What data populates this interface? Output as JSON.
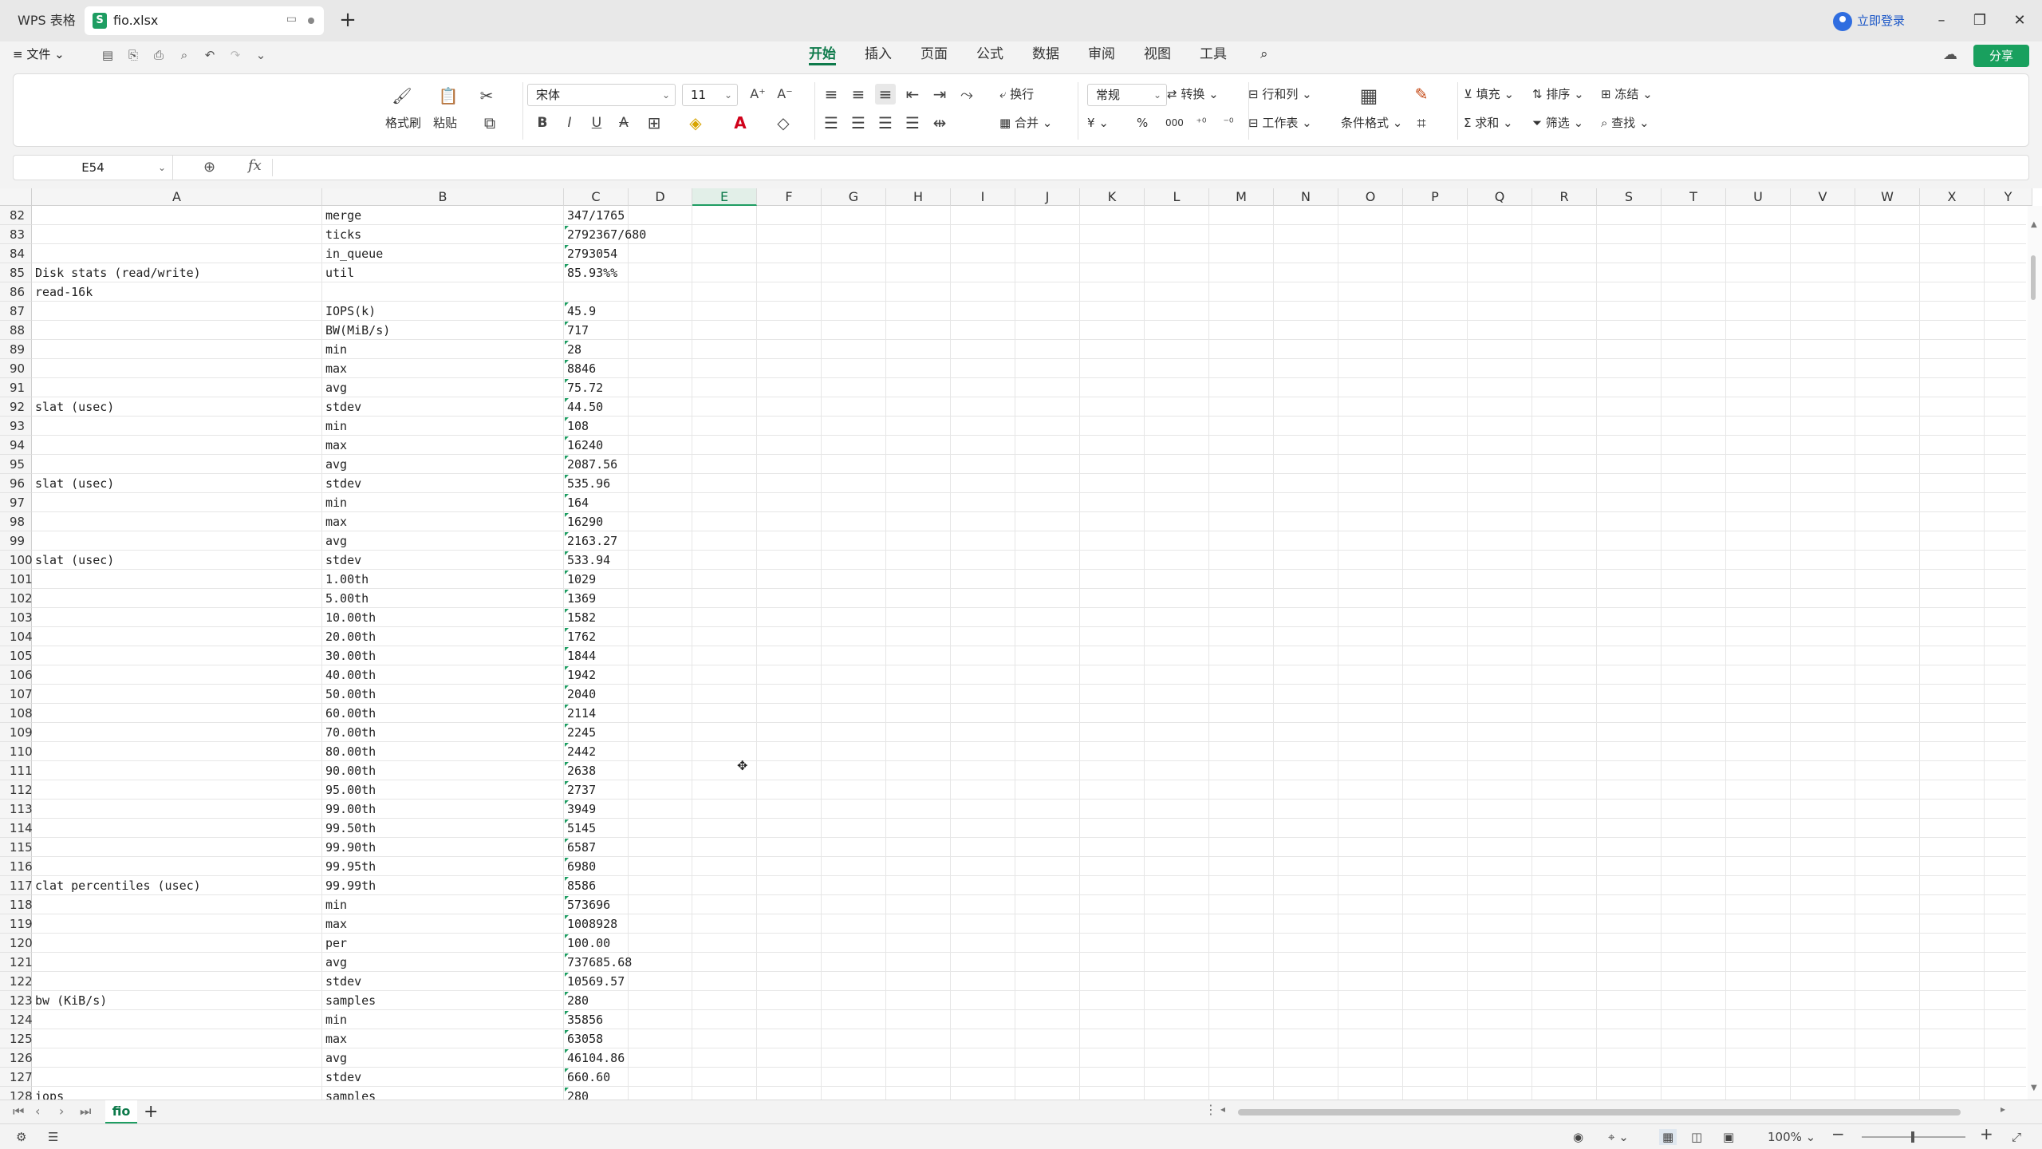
{
  "titlebar": {
    "app_tab": "WPS 表格",
    "file_tab": "fio.xlsx",
    "file_logo": "S",
    "login": "立即登录",
    "new_tab": "+"
  },
  "menubar": {
    "file": "≡ 文件 ⌄",
    "tabs": [
      "开始",
      "插入",
      "页面",
      "公式",
      "数据",
      "审阅",
      "视图",
      "工具"
    ],
    "active_tab": "开始",
    "share": "分享"
  },
  "ribbon": {
    "format_painter": "格式刷",
    "paste": "粘贴",
    "font_name": "宋体",
    "font_size": "11",
    "wrap": "换行",
    "merge": "合并",
    "number_format": "常规",
    "convert": "转换",
    "rows_cols": "行和列",
    "worksheet": "工作表",
    "cond_format": "条件格式",
    "fill": "填充",
    "sort": "排序",
    "freeze": "冻结",
    "sum": "求和",
    "filter": "筛选",
    "find": "查找",
    "currency": "¥",
    "percent": "%",
    "thousands": "000"
  },
  "formula_bar": {
    "cell_ref": "E54",
    "fx": "fx",
    "value": ""
  },
  "grid": {
    "columns": [
      {
        "name": "A"
      },
      {
        "name": "B"
      },
      {
        "name": "C"
      },
      {
        "name": "D"
      },
      {
        "name": "E"
      },
      {
        "name": "F"
      },
      {
        "name": "G"
      },
      {
        "name": "H"
      },
      {
        "name": "I"
      },
      {
        "name": "J"
      },
      {
        "name": "K"
      },
      {
        "name": "L"
      },
      {
        "name": "M"
      },
      {
        "name": "N"
      },
      {
        "name": "O"
      },
      {
        "name": "P"
      },
      {
        "name": "Q"
      },
      {
        "name": "R"
      },
      {
        "name": "S"
      },
      {
        "name": "T"
      },
      {
        "name": "U"
      },
      {
        "name": "V"
      },
      {
        "name": "W"
      },
      {
        "name": "X"
      },
      {
        "name": "Y"
      }
    ],
    "selected_column": "E",
    "rows": [
      {
        "n": "82",
        "a": "",
        "b": "merge",
        "c": "347/1765",
        "tri": false
      },
      {
        "n": "83",
        "a": "",
        "b": "ticks",
        "c": "2792367/680",
        "tri": true
      },
      {
        "n": "84",
        "a": "",
        "b": "in_queue",
        "c": "2793054",
        "tri": true
      },
      {
        "n": "85",
        "a": "Disk stats (read/write)",
        "b": "util",
        "c": "85.93%%",
        "tri": true
      },
      {
        "n": "86",
        "a": "read-16k",
        "b": "",
        "c": "",
        "tri": false
      },
      {
        "n": "87",
        "a": "",
        "b": "IOPS(k)",
        "c": "45.9",
        "tri": true
      },
      {
        "n": "88",
        "a": "",
        "b": "BW(MiB/s)",
        "c": "717",
        "tri": true
      },
      {
        "n": "89",
        "a": "",
        "b": "min",
        "c": "28",
        "tri": true
      },
      {
        "n": "90",
        "a": "",
        "b": "max",
        "c": "8846",
        "tri": true
      },
      {
        "n": "91",
        "a": "",
        "b": "avg",
        "c": "75.72",
        "tri": true
      },
      {
        "n": "92",
        "a": "slat (usec)",
        "b": "stdev",
        "c": "44.50",
        "tri": true
      },
      {
        "n": "93",
        "a": "",
        "b": "min",
        "c": "108",
        "tri": true
      },
      {
        "n": "94",
        "a": "",
        "b": "max",
        "c": "16240",
        "tri": true
      },
      {
        "n": "95",
        "a": "",
        "b": "avg",
        "c": "2087.56",
        "tri": true
      },
      {
        "n": "96",
        "a": "slat (usec)",
        "b": "stdev",
        "c": "535.96",
        "tri": true
      },
      {
        "n": "97",
        "a": "",
        "b": "min",
        "c": "164",
        "tri": true
      },
      {
        "n": "98",
        "a": "",
        "b": "max",
        "c": "16290",
        "tri": true
      },
      {
        "n": "99",
        "a": "",
        "b": "avg",
        "c": "2163.27",
        "tri": true
      },
      {
        "n": "100",
        "a": "slat (usec)",
        "b": "stdev",
        "c": "533.94",
        "tri": true
      },
      {
        "n": "101",
        "a": "",
        "b": "1.00th",
        "c": "1029",
        "tri": true
      },
      {
        "n": "102",
        "a": "",
        "b": "5.00th",
        "c": "1369",
        "tri": true
      },
      {
        "n": "103",
        "a": "",
        "b": "10.00th",
        "c": "1582",
        "tri": true
      },
      {
        "n": "104",
        "a": "",
        "b": "20.00th",
        "c": "1762",
        "tri": true
      },
      {
        "n": "105",
        "a": "",
        "b": "30.00th",
        "c": "1844",
        "tri": true
      },
      {
        "n": "106",
        "a": "",
        "b": "40.00th",
        "c": "1942",
        "tri": true
      },
      {
        "n": "107",
        "a": "",
        "b": "50.00th",
        "c": "2040",
        "tri": true
      },
      {
        "n": "108",
        "a": "",
        "b": "60.00th",
        "c": "2114",
        "tri": true
      },
      {
        "n": "109",
        "a": "",
        "b": "70.00th",
        "c": "2245",
        "tri": true
      },
      {
        "n": "110",
        "a": "",
        "b": "80.00th",
        "c": "2442",
        "tri": true
      },
      {
        "n": "111",
        "a": "",
        "b": "90.00th",
        "c": "2638",
        "tri": true
      },
      {
        "n": "112",
        "a": "",
        "b": "95.00th",
        "c": "2737",
        "tri": true
      },
      {
        "n": "113",
        "a": "",
        "b": "99.00th",
        "c": "3949",
        "tri": true
      },
      {
        "n": "114",
        "a": "",
        "b": "99.50th",
        "c": "5145",
        "tri": true
      },
      {
        "n": "115",
        "a": "",
        "b": "99.90th",
        "c": "6587",
        "tri": true
      },
      {
        "n": "116",
        "a": "",
        "b": "99.95th",
        "c": "6980",
        "tri": true
      },
      {
        "n": "117",
        "a": "clat percentiles (usec)",
        "b": "99.99th",
        "c": "8586",
        "tri": true
      },
      {
        "n": "118",
        "a": "",
        "b": "min",
        "c": "573696",
        "tri": true
      },
      {
        "n": "119",
        "a": "",
        "b": "max",
        "c": "1008928",
        "tri": true
      },
      {
        "n": "120",
        "a": "",
        "b": "per",
        "c": "100.00",
        "tri": true
      },
      {
        "n": "121",
        "a": "",
        "b": "avg",
        "c": "737685.68",
        "tri": true
      },
      {
        "n": "122",
        "a": "",
        "b": "stdev",
        "c": "10569.57",
        "tri": true
      },
      {
        "n": "123",
        "a": "bw (KiB/s)",
        "b": "samples",
        "c": "280",
        "tri": true
      },
      {
        "n": "124",
        "a": "",
        "b": "min",
        "c": "35856",
        "tri": true
      },
      {
        "n": "125",
        "a": "",
        "b": "max",
        "c": "63058",
        "tri": true
      },
      {
        "n": "126",
        "a": "",
        "b": "avg",
        "c": "46104.86",
        "tri": true
      },
      {
        "n": "127",
        "a": "",
        "b": "stdev",
        "c": "660.60",
        "tri": true
      },
      {
        "n": "128",
        "a": "iops",
        "b": "samples",
        "c": "280",
        "tri": true
      }
    ]
  },
  "sheetbar": {
    "sheet_name": "fio",
    "add": "+"
  },
  "statusbar": {
    "zoom": "100%"
  },
  "colors": {
    "accent": "#1e9d62",
    "accent_dark": "#0e7a4b",
    "login_blue": "#1a56c7"
  }
}
